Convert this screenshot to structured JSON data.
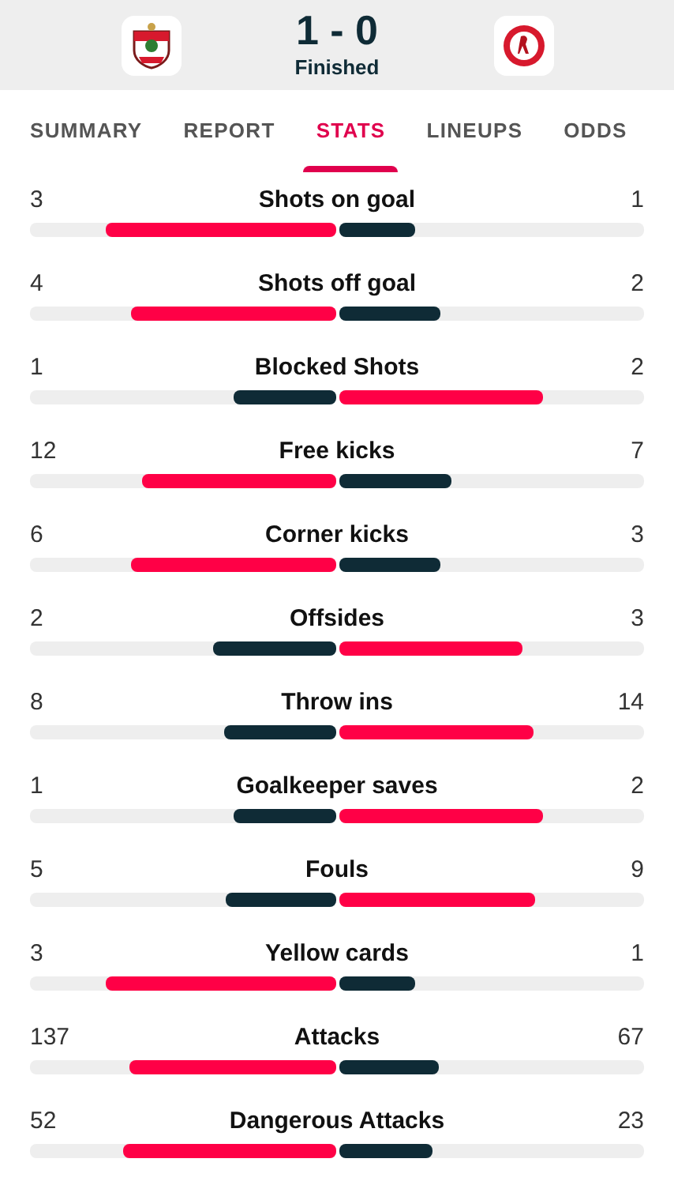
{
  "match": {
    "score": "1 - 0",
    "status": "Finished"
  },
  "tabs": [
    {
      "label": "SUMMARY",
      "selected": false
    },
    {
      "label": "REPORT",
      "selected": false
    },
    {
      "label": "STATS",
      "selected": true
    },
    {
      "label": "LINEUPS",
      "selected": false
    },
    {
      "label": "ODDS",
      "selected": false
    }
  ],
  "stats": [
    {
      "name": "Shots on goal",
      "home": {
        "value": "3",
        "level": 0.75,
        "leading": true
      },
      "away": {
        "value": "1",
        "level": 0.25,
        "leading": false
      }
    },
    {
      "name": "Shots off goal",
      "home": {
        "value": "4",
        "level": 0.667,
        "leading": true
      },
      "away": {
        "value": "2",
        "level": 0.333,
        "leading": false
      }
    },
    {
      "name": "Blocked Shots",
      "home": {
        "value": "1",
        "level": 0.333,
        "leading": false
      },
      "away": {
        "value": "2",
        "level": 0.667,
        "leading": true
      }
    },
    {
      "name": "Free kicks",
      "home": {
        "value": "12",
        "level": 0.632,
        "leading": true
      },
      "away": {
        "value": "7",
        "level": 0.368,
        "leading": false
      }
    },
    {
      "name": "Corner kicks",
      "home": {
        "value": "6",
        "level": 0.667,
        "leading": true
      },
      "away": {
        "value": "3",
        "level": 0.333,
        "leading": false
      }
    },
    {
      "name": "Offsides",
      "home": {
        "value": "2",
        "level": 0.4,
        "leading": false
      },
      "away": {
        "value": "3",
        "level": 0.6,
        "leading": true
      }
    },
    {
      "name": "Throw ins",
      "home": {
        "value": "8",
        "level": 0.364,
        "leading": false
      },
      "away": {
        "value": "14",
        "level": 0.636,
        "leading": true
      }
    },
    {
      "name": "Goalkeeper saves",
      "home": {
        "value": "1",
        "level": 0.333,
        "leading": false
      },
      "away": {
        "value": "2",
        "level": 0.667,
        "leading": true
      }
    },
    {
      "name": "Fouls",
      "home": {
        "value": "5",
        "level": 0.357,
        "leading": false
      },
      "away": {
        "value": "9",
        "level": 0.643,
        "leading": true
      }
    },
    {
      "name": "Yellow cards",
      "home": {
        "value": "3",
        "level": 0.75,
        "leading": true
      },
      "away": {
        "value": "1",
        "level": 0.25,
        "leading": false
      }
    },
    {
      "name": "Attacks",
      "home": {
        "value": "137",
        "level": 0.672,
        "leading": true
      },
      "away": {
        "value": "67",
        "level": 0.328,
        "leading": false
      }
    },
    {
      "name": "Dangerous Attacks",
      "home": {
        "value": "52",
        "level": 0.693,
        "leading": true
      },
      "away": {
        "value": "23",
        "level": 0.307,
        "leading": false
      }
    }
  ]
}
